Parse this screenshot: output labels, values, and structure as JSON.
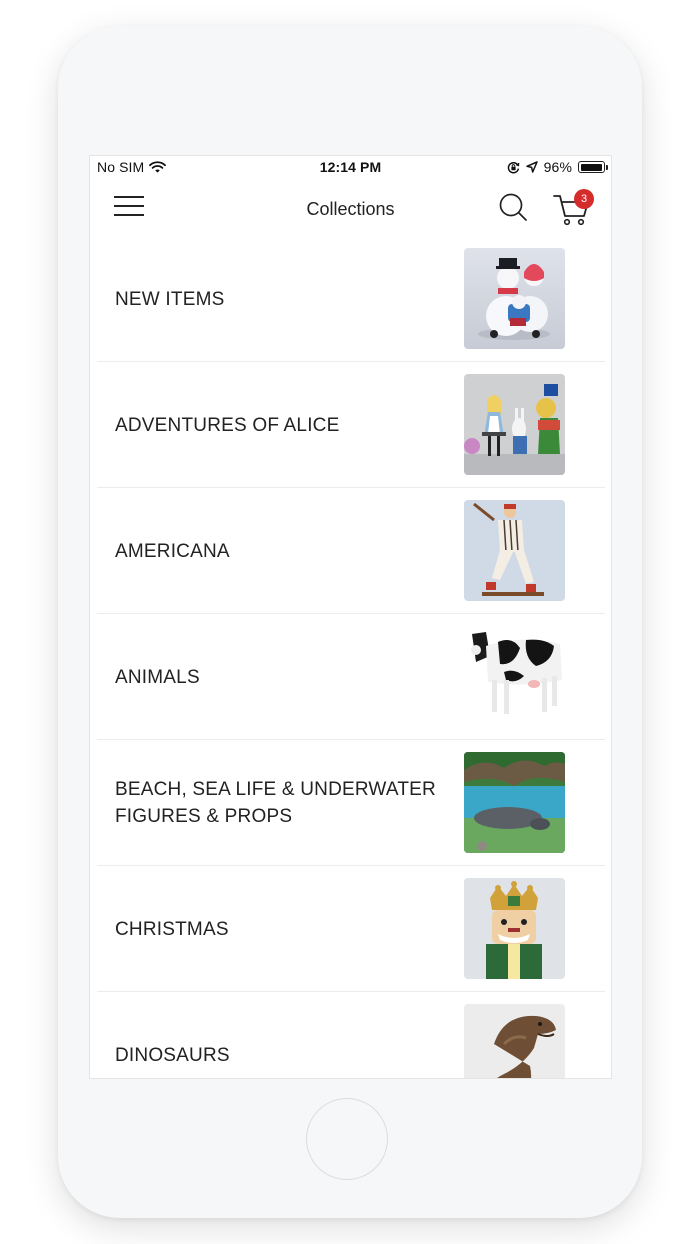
{
  "status_bar": {
    "carrier": "No SIM",
    "time": "12:14 PM",
    "battery_percent": "96%",
    "battery_level": 0.96
  },
  "nav": {
    "title": "Collections",
    "menu_icon": "hamburger-menu-icon",
    "search_icon": "search-icon",
    "cart_icon": "cart-icon",
    "cart_count": "3"
  },
  "colors": {
    "badge": "#d62b2b",
    "text": "#222222",
    "divider": "#ececec"
  },
  "collections": [
    {
      "label": "NEW ITEMS",
      "thumbnail": "snowmen-figures-photo"
    },
    {
      "label": "ADVENTURES OF ALICE",
      "thumbnail": "alice-figures-photo"
    },
    {
      "label": "AMERICANA",
      "thumbnail": "baseball-player-statue-photo"
    },
    {
      "label": "ANIMALS",
      "thumbnail": "cow-statue-photo"
    },
    {
      "label": "BEACH, SEA LIFE & UNDERWATER FIGURES & PROPS",
      "thumbnail": "manatee-pool-photo"
    },
    {
      "label": "CHRISTMAS",
      "thumbnail": "nutcracker-photo"
    },
    {
      "label": "DINOSAURS",
      "thumbnail": "t-rex-statue-photo"
    }
  ]
}
